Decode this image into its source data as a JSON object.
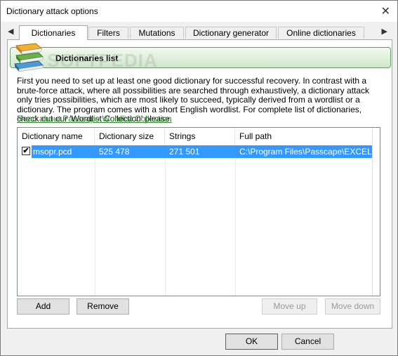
{
  "window": {
    "title": "Dictionary attack options",
    "close_glyph": "✕"
  },
  "tabs": {
    "left_arrow": "◀",
    "right_arrow": "▶",
    "items": [
      "Dictionaries",
      "Filters",
      "Mutations",
      "Dictionary generator",
      "Online dictionaries"
    ],
    "active": "Dictionaries"
  },
  "header": {
    "title": "Dictionaries list",
    "icon": "books-icon",
    "watermark": "SOFTPEDIA"
  },
  "description": "First you need to set up at least one good dictionary for successful recovery. In contrast with a brute-force attack, where all possibilities are searched through exhaustively, a dictionary attack only tries possibilities, which are most likely to succeed, typically derived from a wordlist or a dictionary. The program comes with a short English wordlist. For complete list of dictionaries, check out our 'Wordlist Collection' please.",
  "link": "Read about Passcape Wordlist Collection",
  "list": {
    "columns": [
      "Dictionary name",
      "Dictionary size",
      "Strings",
      "Full path"
    ],
    "rows": [
      {
        "checked": "✔",
        "name": "msopr.pcd",
        "size": "525 478",
        "strings": "271 501",
        "path": "C:\\Program Files\\Passcape\\EXCELPR..."
      }
    ]
  },
  "buttons": {
    "add": "Add",
    "remove": "Remove",
    "move_up": "Move up",
    "move_down": "Move down",
    "ok": "OK",
    "cancel": "Cancel"
  },
  "colors": {
    "selection": "#3399ff",
    "link": "#2f8a2f",
    "header_border": "#6c9c68"
  }
}
